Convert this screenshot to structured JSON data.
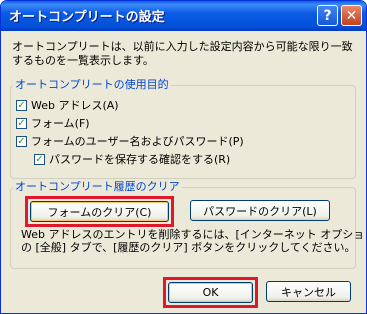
{
  "window": {
    "title": "オートコンプリートの設定",
    "help_icon": "help-icon",
    "close_icon": "close-icon"
  },
  "description": "オートコンプリートは、以前に入力した設定内容から可能な限り一致するものを一覧表示します。",
  "usage_group": {
    "legend": "オートコンプリートの使用目的",
    "options": [
      {
        "label": "Web アドレス(A)",
        "checked": true
      },
      {
        "label": "フォーム(F)",
        "checked": true
      },
      {
        "label": "フォームのユーザー名およびパスワード(P)",
        "checked": true
      },
      {
        "label": "パスワードを保存する確認をする(R)",
        "checked": true
      }
    ]
  },
  "history_group": {
    "legend": "オートコンプリート履歴のクリア",
    "clear_forms_label": "フォームのクリア(C)",
    "clear_passwords_label": "パスワードのクリア(L)",
    "note_line1": "Web アドレスのエントリを削除するには、[インターネット オプション]",
    "note_line2": "の [全般] タブで、[履歴のクリア] ボタンをクリックしてください。"
  },
  "buttons": {
    "ok_label": "OK",
    "cancel_label": "キャンセル"
  },
  "colors": {
    "titlebar": "#0a5fe8",
    "highlight": "#e0182b",
    "legend_text": "#0046d5",
    "checkmark": "#21a121"
  }
}
